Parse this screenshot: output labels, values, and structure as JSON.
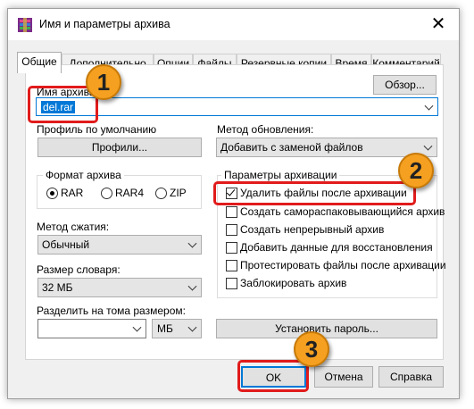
{
  "window": {
    "title": "Имя и параметры архива",
    "close_glyph": "✕"
  },
  "tabs": [
    {
      "label": "Общие",
      "active": true
    },
    {
      "label": "Дополнительно"
    },
    {
      "label": "Опции"
    },
    {
      "label": "Файлы"
    },
    {
      "label": "Резервные копии"
    },
    {
      "label": "Время"
    },
    {
      "label": "Комментарий"
    }
  ],
  "archive_name": {
    "label": "Имя архива",
    "value": "del.rar",
    "browse_button": "Обзор..."
  },
  "profile": {
    "label": "Профиль по умолчанию",
    "button": "Профили..."
  },
  "update_method": {
    "label": "Метод обновления:",
    "value": "Добавить с заменой файлов"
  },
  "archive_format": {
    "title": "Формат архива",
    "options": [
      "RAR",
      "RAR4",
      "ZIP"
    ],
    "selected": "RAR"
  },
  "compression": {
    "label": "Метод сжатия:",
    "value": "Обычный"
  },
  "dictionary": {
    "label": "Размер словаря:",
    "value": "32 МБ"
  },
  "split": {
    "label": "Разделить на тома размером:",
    "value": "",
    "unit": "МБ"
  },
  "archive_options": {
    "title": "Параметры архивации",
    "items": [
      {
        "label": "Удалить файлы после архивации",
        "checked": true
      },
      {
        "label": "Создать самораспаковывающийся архив",
        "checked": false
      },
      {
        "label": "Создать непрерывный архив",
        "checked": false
      },
      {
        "label": "Добавить данные для восстановления",
        "checked": false
      },
      {
        "label": "Протестировать файлы после архивации",
        "checked": false
      },
      {
        "label": "Заблокировать архив",
        "checked": false
      }
    ]
  },
  "password_button": "Установить пароль...",
  "footer": {
    "ok": "OK",
    "cancel": "Отмена",
    "help": "Справка"
  },
  "step_badges": [
    "1",
    "2",
    "3"
  ],
  "colors": {
    "highlight": "#e11b1b",
    "badge": "#f5a020",
    "selection": "#0078d7"
  }
}
